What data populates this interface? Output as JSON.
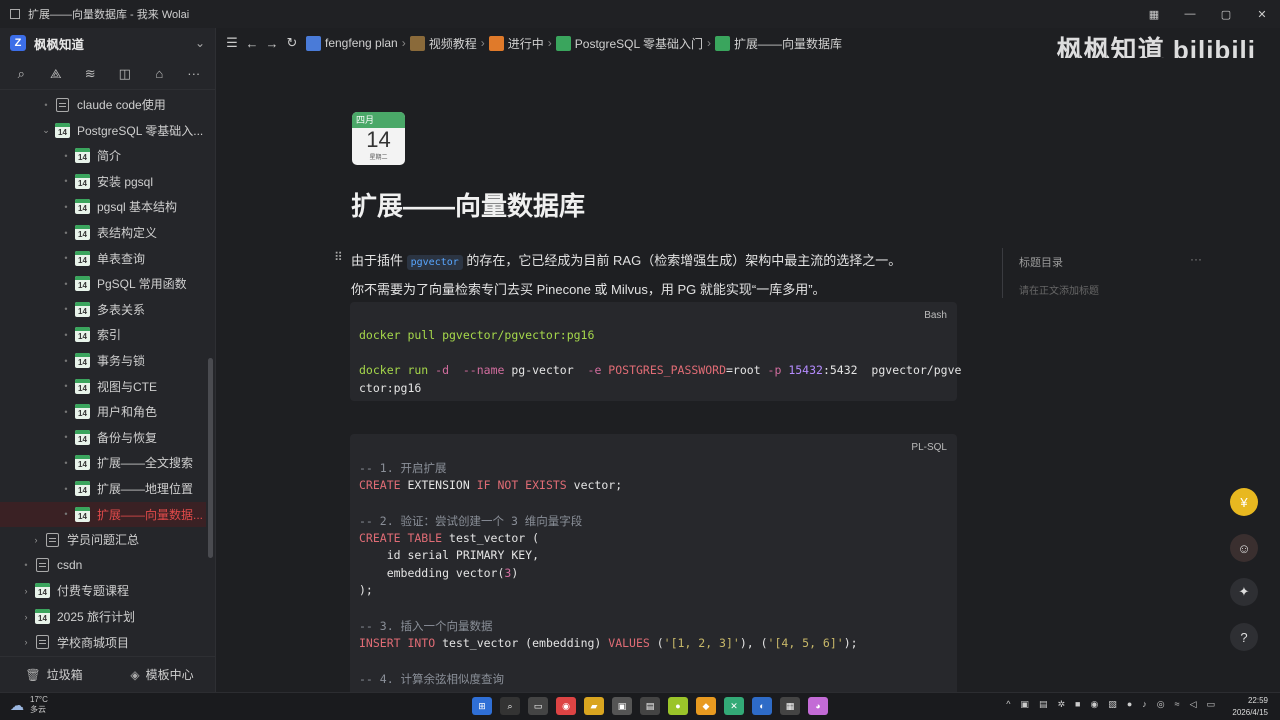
{
  "window": {
    "title": "扩展——向量数据库 - 我来 Wolai"
  },
  "sidebar": {
    "workspace_name": "枫枫知道",
    "tools": [
      "search-icon",
      "graph-icon",
      "bolt-icon",
      "chart-icon",
      "inbox-icon",
      "more-icon"
    ],
    "items": [
      {
        "label": "claude code使用",
        "icon": "doc",
        "depth": 1,
        "caret": "dot"
      },
      {
        "label": "PostgreSQL 零基础入...",
        "icon": "cal",
        "depth": 1,
        "caret": "open"
      },
      {
        "label": "简介",
        "icon": "cal",
        "depth": 2,
        "caret": "dot"
      },
      {
        "label": "安装 pgsql",
        "icon": "cal",
        "depth": 2,
        "caret": "dot"
      },
      {
        "label": "pgsql 基本结构",
        "icon": "cal",
        "depth": 2,
        "caret": "dot"
      },
      {
        "label": "表结构定义",
        "icon": "cal",
        "depth": 2,
        "caret": "dot"
      },
      {
        "label": "单表查询",
        "icon": "cal",
        "depth": 2,
        "caret": "dot"
      },
      {
        "label": "PgSQL 常用函数",
        "icon": "cal",
        "depth": 2,
        "caret": "dot"
      },
      {
        "label": "多表关系",
        "icon": "cal",
        "depth": 2,
        "caret": "dot"
      },
      {
        "label": "索引",
        "icon": "cal",
        "depth": 2,
        "caret": "dot"
      },
      {
        "label": "事务与锁",
        "icon": "cal",
        "depth": 2,
        "caret": "dot"
      },
      {
        "label": "视图与CTE",
        "icon": "cal",
        "depth": 2,
        "caret": "dot"
      },
      {
        "label": "用户和角色",
        "icon": "cal",
        "depth": 2,
        "caret": "dot"
      },
      {
        "label": "备份与恢复",
        "icon": "cal",
        "depth": 2,
        "caret": "dot"
      },
      {
        "label": "扩展——全文搜索",
        "icon": "cal",
        "depth": 2,
        "caret": "dot"
      },
      {
        "label": "扩展——地理位置",
        "icon": "cal",
        "depth": 2,
        "caret": "dot"
      },
      {
        "label": "扩展——向量数据...",
        "icon": "cal",
        "depth": 2,
        "caret": "dot",
        "active": true
      },
      {
        "label": "学员问题汇总",
        "icon": "doc",
        "depth": 0.5,
        "caret": "closed"
      },
      {
        "label": "csdn",
        "icon": "doc",
        "depth": 0,
        "caret": "dot"
      },
      {
        "label": "付费专题课程",
        "icon": "cal",
        "depth": 0,
        "caret": "closed"
      },
      {
        "label": "2025 旅行计划",
        "icon": "cal",
        "depth": 0,
        "caret": "closed"
      },
      {
        "label": "学校商城项目",
        "icon": "doc",
        "depth": 0,
        "caret": "closed"
      }
    ],
    "trash_label": "垃圾箱",
    "templates_label": "模板中心"
  },
  "topbar": {
    "breadcrumbs": [
      {
        "label": "fengfeng plan",
        "color": "#4a7bd8"
      },
      {
        "label": "视频教程",
        "color": "#8a6a3a"
      },
      {
        "label": "进行中",
        "color": "#e07a2a"
      },
      {
        "label": "PostgreSQL 零基础入门",
        "color": "#3aa55d"
      },
      {
        "label": "扩展——向量数据库",
        "color": "#3aa55d"
      }
    ],
    "watermark": "枫枫知道 bilibili"
  },
  "doc": {
    "calendar": {
      "month": "四月",
      "day": "14",
      "weekday": "星期二"
    },
    "title": "扩展——向量数据库",
    "para1_pre": "由于插件 ",
    "para1_code": "pgvector",
    "para1_post": " 的存在，它已经成为目前 RAG（检索增强生成）架构中最主流的选择之一。",
    "para2": "你不需要为了向量检索专门去买 Pinecone 或 Milvus，用 PG 就能实现“一库多用”。",
    "bash_lang": "Bash",
    "bash_lines": {
      "l1": "docker pull pgvector/pgvector:pg16",
      "l2_cmd": "docker run ",
      "l2_d": "-d",
      "l2_name_flag": "  --name",
      "l2_name": " pg-vector  ",
      "l2_e": "-e",
      "l2_env": " POSTGRES_PASSWORD",
      "l2_eq": "=root ",
      "l2_p": "-p",
      "l2_port": " 15432",
      "l2_rest": ":5432  pgvector/pgve",
      "l3": "ctor:pg16"
    },
    "sql_lang": "PL-SQL",
    "sql_lines": {
      "c1": "-- 1. 开启扩展",
      "s1a": "CREATE",
      "s1b": " EXTENSION ",
      "s1c": "IF NOT EXISTS",
      "s1d": " vector;",
      "c2": "-- 2. 验证：尝试创建一个 3 维向量字段",
      "s2a": "CREATE TABLE",
      "s2b": " test_vector (",
      "s3": "    id serial PRIMARY KEY,",
      "s4a": "    embedding vector(",
      "s4b": "3",
      "s4c": ")",
      "s5": ");",
      "c3": "-- 3. 插入一个向量数据",
      "s6a": "INSERT INTO",
      "s6b": " test_vector (embedding) ",
      "s6c": "VALUES",
      "s6d": " (",
      "s6e": "'[1, 2, 3]'",
      "s6f": "), (",
      "s6g": "'[4, 5, 6]'",
      "s6h": ");",
      "c4": "-- 4. 计算余弦相似度查询"
    }
  },
  "toc": {
    "title": "标题目录",
    "empty_hint": "请在正文添加标题"
  },
  "taskbar": {
    "temp": "17°C",
    "weather": "多云",
    "time": "22:59",
    "date": "2026/4/15"
  }
}
